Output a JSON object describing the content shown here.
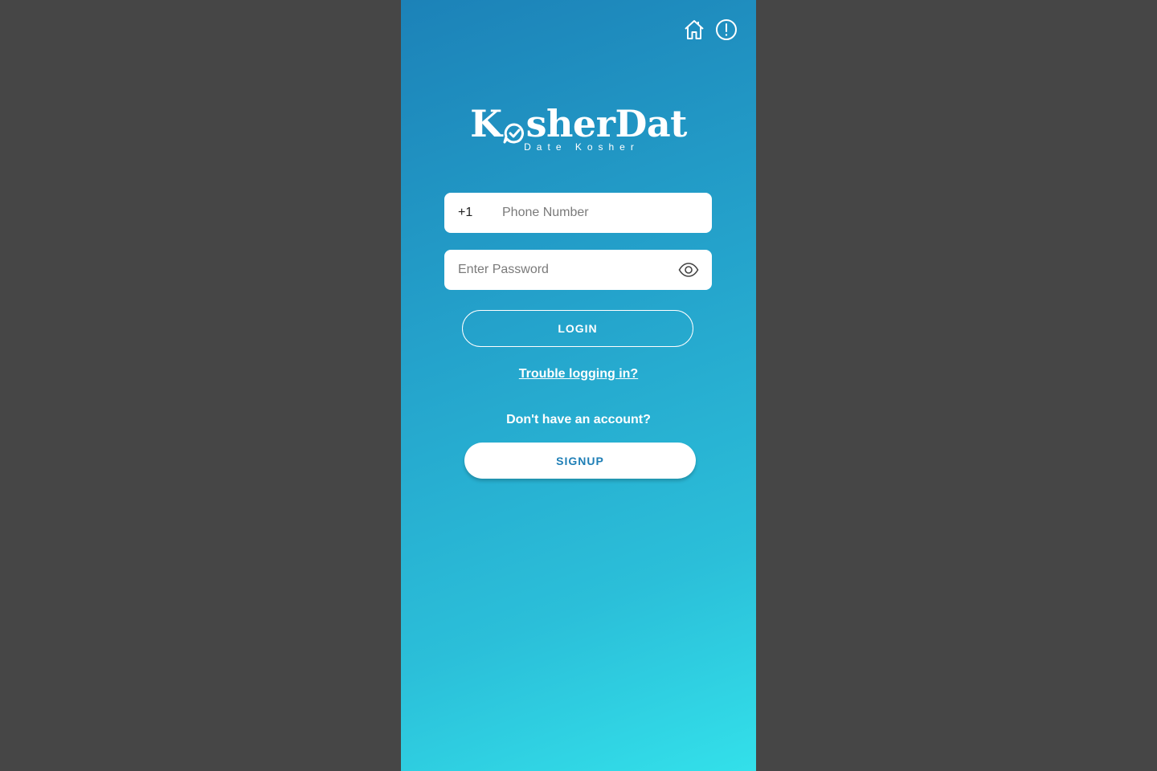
{
  "brand": {
    "name_part1": "K",
    "name_part2": "sherDat",
    "tagline": "Date Kosher"
  },
  "top_icons": [
    "home-icon",
    "alert-icon"
  ],
  "phone_field": {
    "prefix": "+1",
    "placeholder": "Phone Number",
    "value": ""
  },
  "password_field": {
    "placeholder": "Enter Password",
    "value": ""
  },
  "login_button": "LOGIN",
  "trouble_link": "Trouble logging in?",
  "no_account_text": "Don't have an account?",
  "signup_button": "SIGNUP",
  "colors": {
    "gradient_start": "#1c82b8",
    "gradient_end": "#33e0ea",
    "background": "#464646",
    "signup_text": "#1f7fb6"
  }
}
